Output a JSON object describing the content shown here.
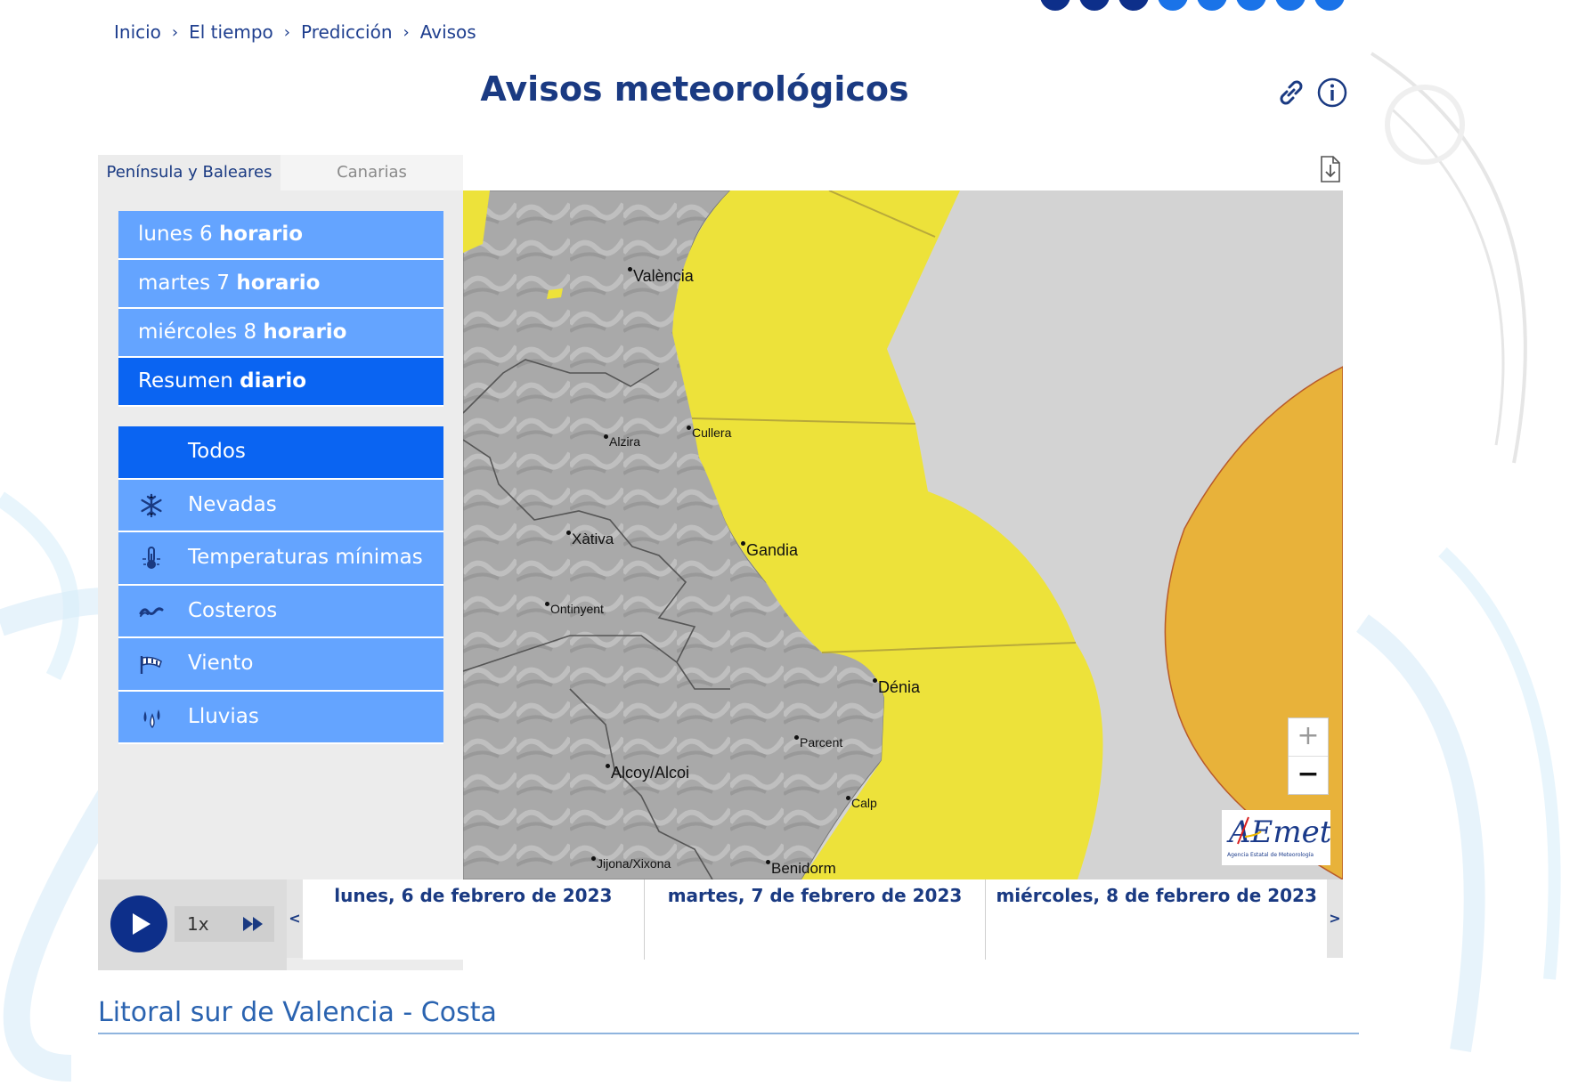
{
  "breadcrumb": [
    "Inicio",
    "El tiempo",
    "Predicción",
    "Avisos"
  ],
  "breadcrumb_separator": "›",
  "page_title": "Avisos meteorológicos",
  "icons": {
    "link": "link-icon",
    "info": "info-icon",
    "download": "download-icon"
  },
  "tabs": {
    "active": "Península y Baleares",
    "inactive": "Canarias"
  },
  "days": [
    {
      "prefix": "lunes 6",
      "suffix": "horario",
      "selected": false
    },
    {
      "prefix": "martes 7",
      "suffix": "horario",
      "selected": false
    },
    {
      "prefix": "miércoles 8",
      "suffix": "horario",
      "selected": false
    },
    {
      "prefix": "Resumen",
      "suffix": "diario",
      "selected": true
    }
  ],
  "types": [
    {
      "label": "Todos",
      "icon": "",
      "selected": true
    },
    {
      "label": "Nevadas",
      "icon": "snowflake-icon",
      "selected": false
    },
    {
      "label": "Temperaturas mínimas",
      "icon": "thermometer-icon",
      "selected": false
    },
    {
      "label": "Costeros",
      "icon": "waves-icon",
      "selected": false
    },
    {
      "label": "Viento",
      "icon": "wind-icon",
      "selected": false
    },
    {
      "label": "Lluvias",
      "icon": "rain-icon",
      "selected": false
    }
  ],
  "map": {
    "cities": {
      "valencia": "València",
      "alzira": "Alzira",
      "cullera": "Cullera",
      "xativa": "Xàtiva",
      "gandia": "Gandia",
      "ontinyent": "Ontinyent",
      "denia": "Dénia",
      "parcent": "Parcent",
      "alcoy": "Alcoy/Alcoi",
      "calp": "Calp",
      "jijona": "Jijona/Xixona",
      "benidorm": "Benidorm"
    },
    "zoom_in": "+",
    "zoom_out": "−",
    "logo_text": "AEmet",
    "logo_subtext": "Agencia Estatal de Meteorología",
    "colors": {
      "yellow_warning": "#ede23a",
      "orange_warning": "#e8b23a",
      "sea": "#d3d3d3"
    }
  },
  "player": {
    "speed": "1x",
    "prev": "<",
    "next": ">"
  },
  "timeline": [
    "lunes, 6 de febrero de 2023",
    "martes, 7 de febrero de 2023",
    "miércoles, 8 de febrero de 2023"
  ],
  "zone_title": "Litoral sur de Valencia - Costa"
}
